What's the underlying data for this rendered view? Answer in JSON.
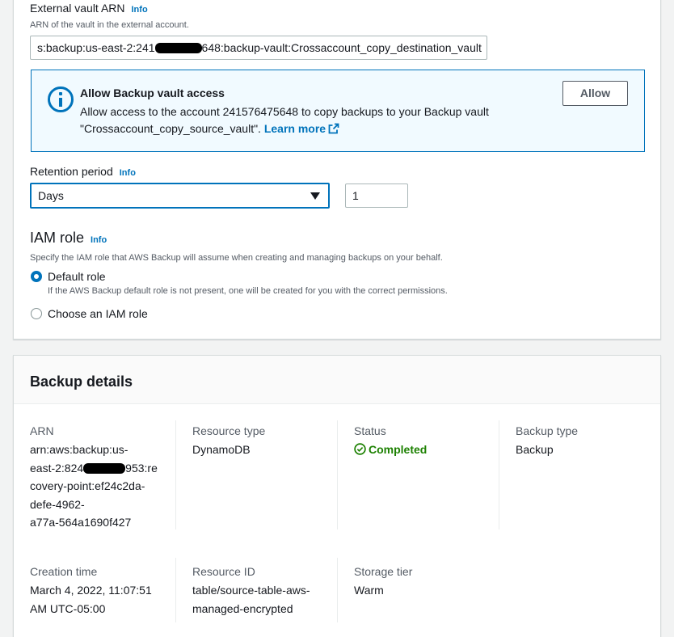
{
  "vault": {
    "label": "External vault ARN",
    "info": "Info",
    "description": "ARN of the vault in the external account.",
    "value_prefix": "s:backup:us-east-2:241",
    "value_suffix": "648:backup-vault:Crossaccount_copy_destination_vault"
  },
  "alert": {
    "title": "Allow Backup vault access",
    "body_line1": "Allow access to the account 241576475648 to copy backups to your Backup vault",
    "body_line2": "\"Crossaccount_copy_source_vault\".",
    "learn_more": "Learn more",
    "button": "Allow",
    "icon": "info-circle-icon",
    "color": "#0073bb"
  },
  "retention": {
    "label": "Retention period",
    "info": "Info",
    "unit": "Days",
    "value": "1"
  },
  "iam": {
    "title": "IAM role",
    "info": "Info",
    "description": "Specify the IAM role that AWS Backup will assume when creating and managing backups on your behalf.",
    "options": [
      {
        "label": "Default role",
        "hint": "If the AWS Backup default role is not present, one will be created for you with the correct permissions.",
        "selected": true
      },
      {
        "label": "Choose an IAM role",
        "selected": false
      }
    ]
  },
  "details": {
    "title": "Backup details",
    "arn_key": "ARN",
    "arn_l1": "arn:aws:backup:us-",
    "arn_l2a": "east-2:824",
    "arn_l2b": "953:re",
    "arn_l3": "covery-point:ef24c2da-",
    "arn_l4": "defe-4962-",
    "arn_l5": "a77a-564a1690f427",
    "resource_type_key": "Resource type",
    "resource_type": "DynamoDB",
    "status_key": "Status",
    "status": "Completed",
    "status_color": "#1d8102",
    "backup_type_key": "Backup type",
    "backup_type": "Backup",
    "creation_key": "Creation time",
    "creation_l1": "March 4, 2022, 11:07:51",
    "creation_l2": "AM UTC-05:00",
    "resource_id_key": "Resource ID",
    "resource_id_l1": "table/source-table-aws-",
    "resource_id_l2": "managed-encrypted",
    "storage_key": "Storage tier",
    "storage": "Warm"
  }
}
